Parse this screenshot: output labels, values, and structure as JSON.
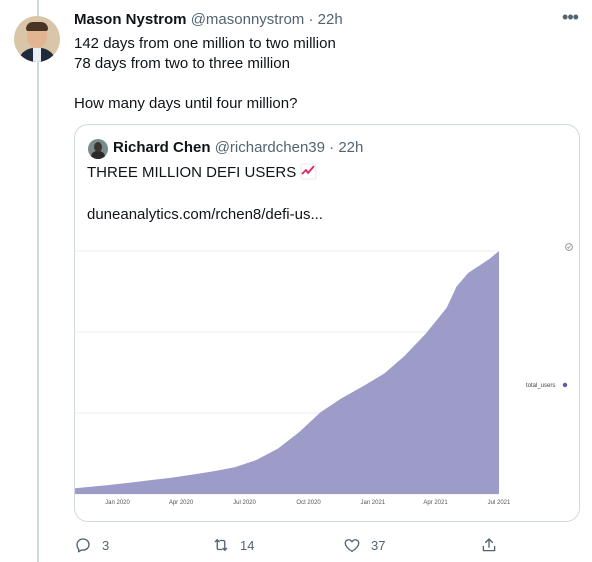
{
  "author": {
    "name": "Mason Nystrom",
    "handle": "@masonnystrom",
    "time": "22h"
  },
  "tweet": {
    "lines": [
      "142 days from one million to two million",
      "78 days from two to three million",
      "",
      "How many days until four million?"
    ]
  },
  "quote": {
    "author": {
      "name": "Richard Chen",
      "handle": "@richardchen39",
      "time": "22h"
    },
    "text": "THREE MILLION DEFI USERS",
    "link": "duneanalytics.com/rchen8/defi-us..."
  },
  "chart_data": {
    "type": "area",
    "series": [
      {
        "name": "total_users",
        "color": "#9d9bc8",
        "x": [
          "2019-11-15",
          "2020-01-01",
          "2020-02-01",
          "2020-03-01",
          "2020-04-01",
          "2020-05-01",
          "2020-06-01",
          "2020-07-01",
          "2020-08-01",
          "2020-09-01",
          "2020-10-01",
          "2020-11-01",
          "2020-12-01",
          "2021-01-01",
          "2021-02-01",
          "2021-03-01",
          "2021-04-01",
          "2021-05-01",
          "2021-05-15",
          "2021-06-01",
          "2021-07-01",
          "2021-07-15"
        ],
        "values": [
          70000,
          110000,
          140000,
          170000,
          200000,
          240000,
          280000,
          330000,
          420000,
          560000,
          760000,
          1010000,
          1180000,
          1330000,
          1490000,
          1700000,
          1980000,
          2300000,
          2560000,
          2730000,
          2900000,
          3000000
        ]
      }
    ],
    "tick_labels": [
      "Jan 2020",
      "Apr 2020",
      "Jul 2020",
      "Oct 2020",
      "Jan 2021",
      "Apr 2021",
      "Jul 2021"
    ],
    "legend": "right",
    "grid": true
  },
  "actions": {
    "replies": "3",
    "retweets": "14",
    "likes": "37"
  },
  "colors": {
    "muted": "#536471",
    "border": "#cfd9de",
    "area": "#9d9bc8",
    "legend_dot": "#5c5aa8"
  }
}
